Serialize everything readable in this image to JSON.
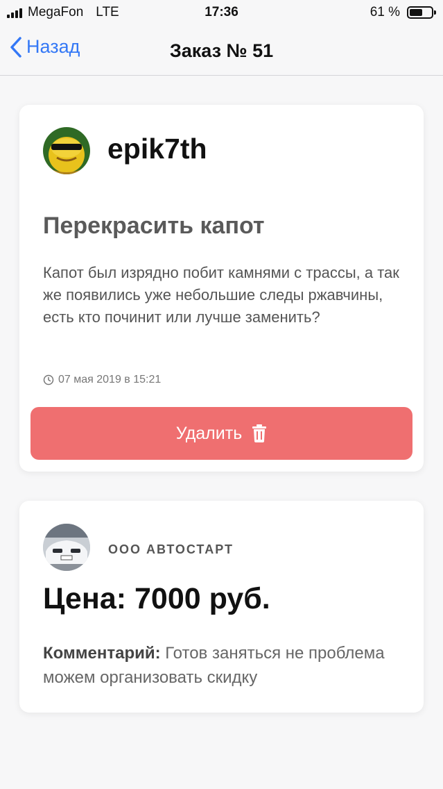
{
  "status_bar": {
    "carrier": "MegaFon",
    "network": "LTE",
    "time": "17:36",
    "battery": "61 %",
    "battery_level": 0.61
  },
  "nav": {
    "back_label": "Назад",
    "title": "Заказ № 51"
  },
  "order": {
    "username": "epik7th",
    "title": "Перекрасить капот",
    "description": "Капот был изрядно побит камнями с трассы, а так же появились уже небольшие следы ржавчины, есть кто починит или лучше заменить?",
    "date": "07 мая 2019 в 15:21",
    "delete_label": "Удалить"
  },
  "offer": {
    "company": "ООО АВТОСТАРТ",
    "price": "Цена: 7000 руб.",
    "comment_label": "Комментарий:",
    "comment_text": " Готов заняться не проблема можем организовать скидку"
  },
  "colors": {
    "accent": "#3478f6",
    "danger": "#ef6f70"
  },
  "icons": {
    "back": "chevron-left-icon",
    "clock": "clock-icon",
    "trash": "trash-icon"
  }
}
